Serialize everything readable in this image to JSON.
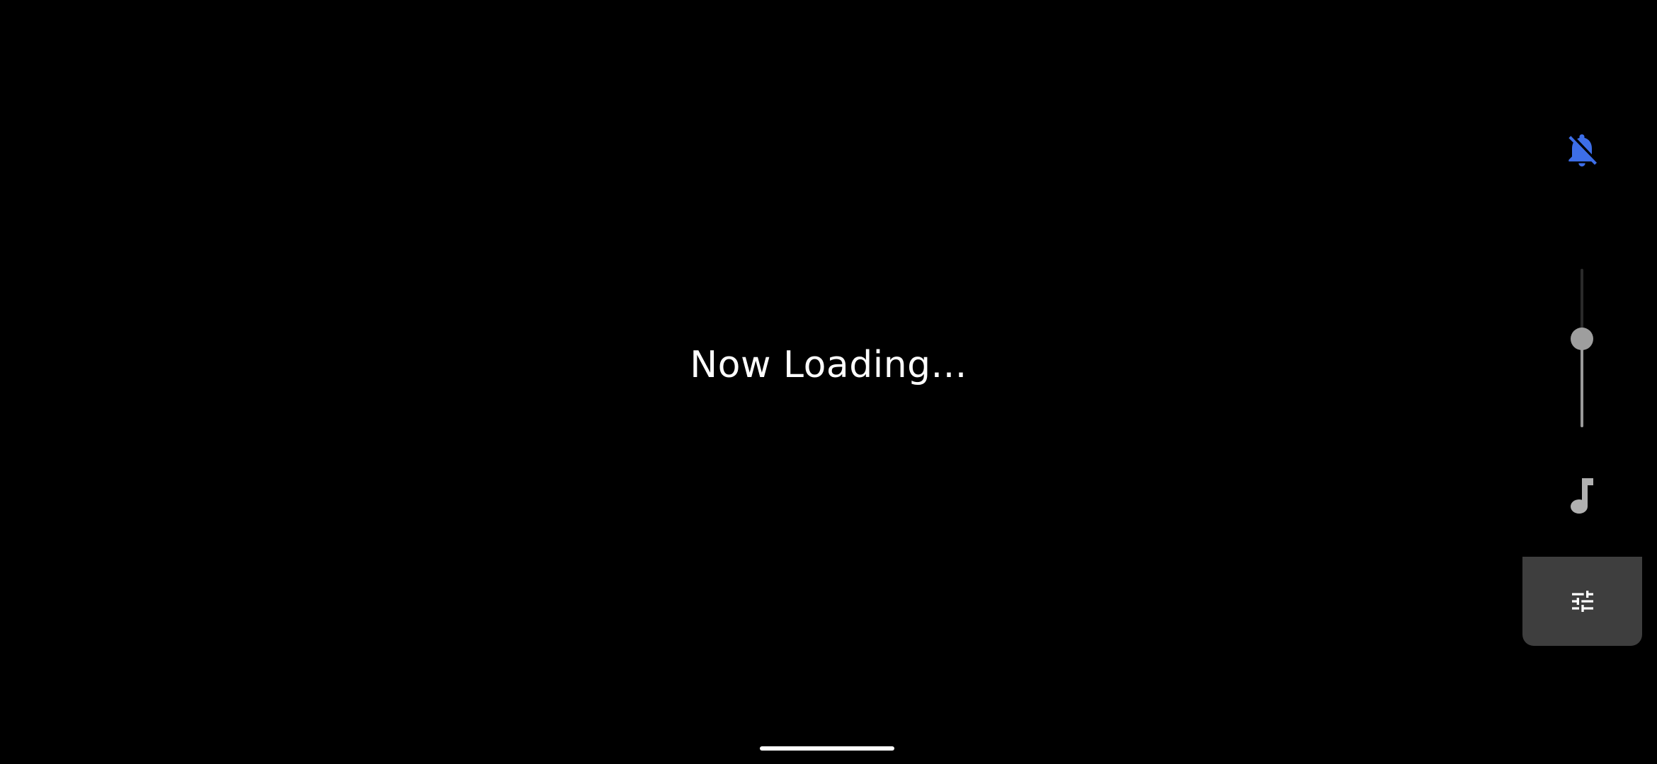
{
  "screen": {
    "loading_text": "Now Loading..."
  },
  "volume_panel": {
    "ringer_icon": "bell-off-icon",
    "ringer_mode": "muted",
    "slider_level": 0.56,
    "stream_icon": "music-note-icon",
    "settings_icon": "tune-sliders-icon"
  },
  "colors": {
    "background": "#000000",
    "loading_text": "#ffffff",
    "ringer_accent": "#3d6ee8",
    "slider_thumb": "#9e9e9e",
    "slider_fill": "#9a9a9a",
    "settings_button_bg": "#3e3e3e",
    "home_indicator": "#ffffff"
  }
}
